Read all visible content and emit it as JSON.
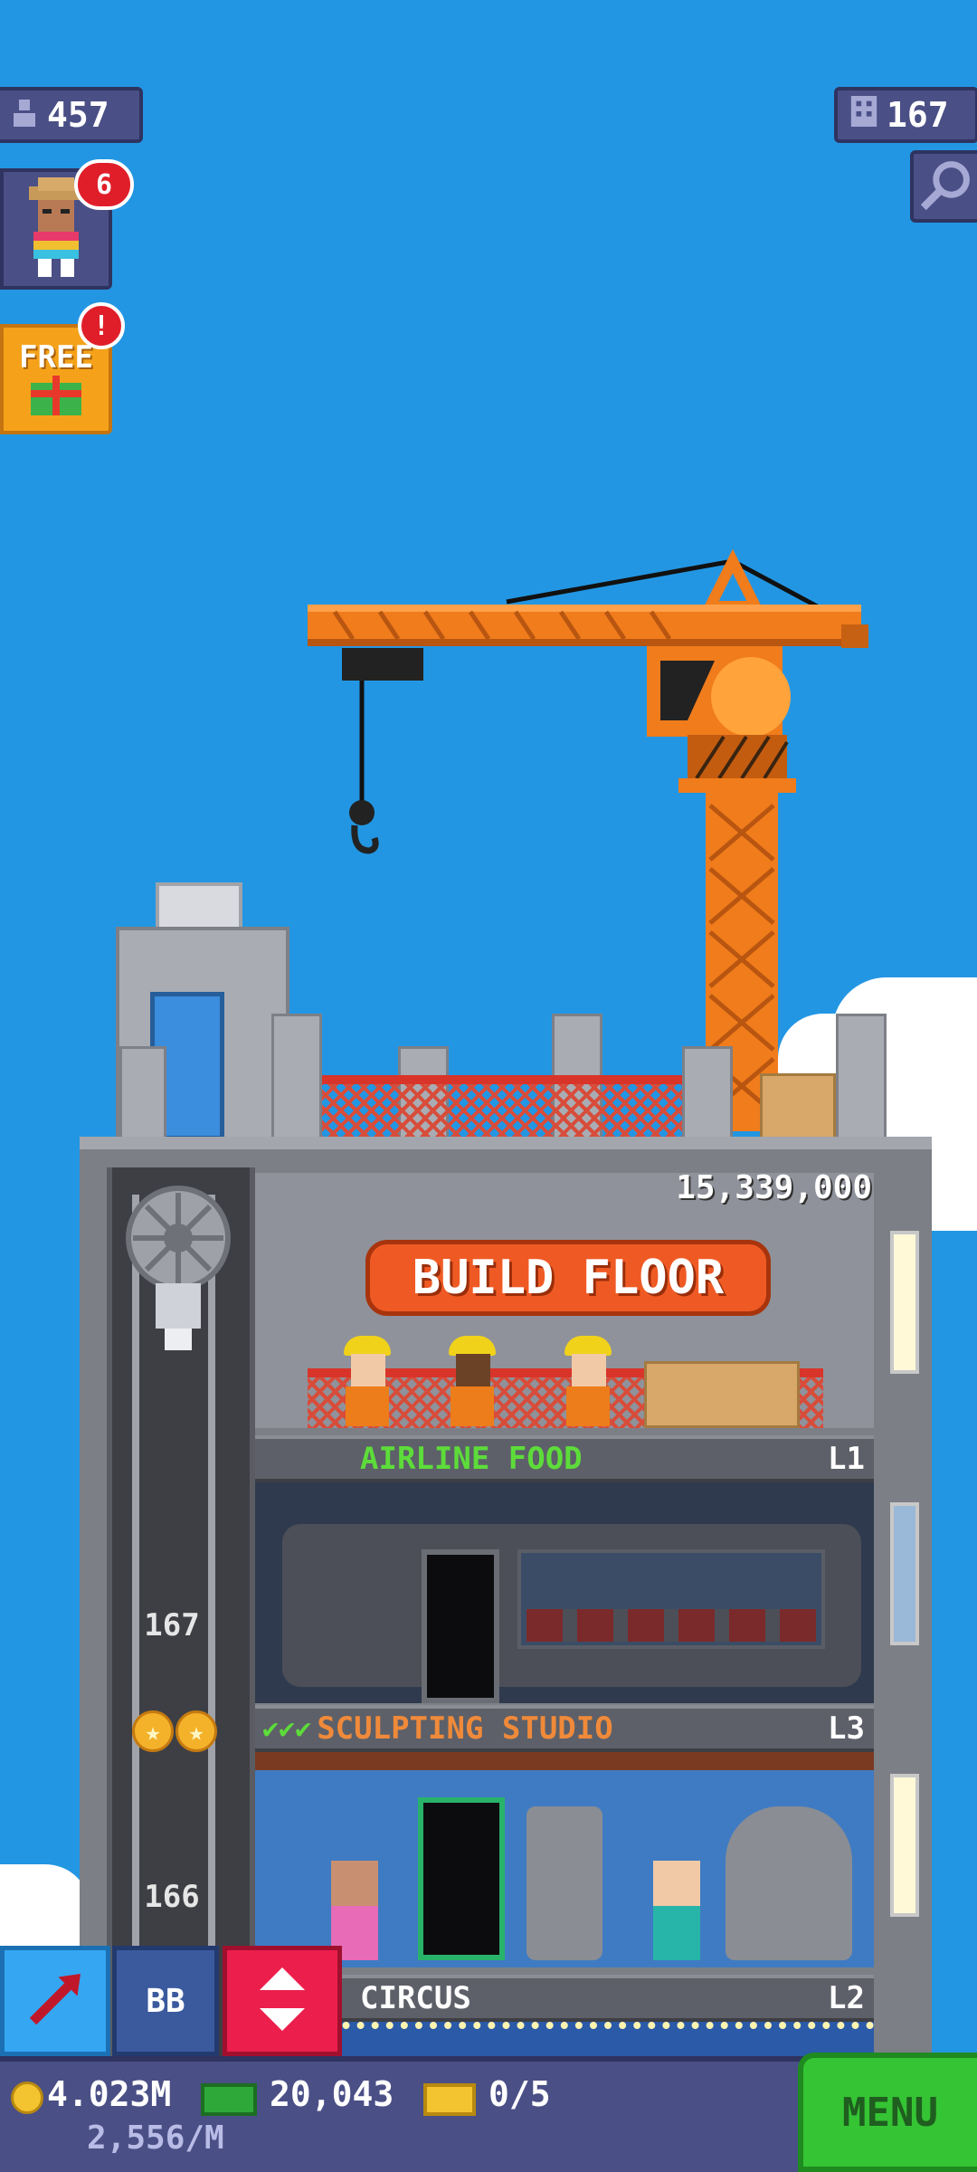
{
  "hud": {
    "population": "457",
    "floors": "167",
    "notification_count": "6",
    "free_label": "FREE",
    "free_badge": "!"
  },
  "tower": {
    "build_cost": "15,339,000",
    "build_label": "BUILD FLOOR",
    "elevator_floors": [
      "167",
      "166"
    ],
    "floors": [
      {
        "name": "AIRLINE FOOD",
        "level": "L1",
        "name_color": "#5ddc3a"
      },
      {
        "name": "SCULPTING STUDIO",
        "level": "L3",
        "name_color": "#f08a3a"
      },
      {
        "name": "CIRCUS",
        "level": "L2",
        "name_color": "#ffffff"
      }
    ]
  },
  "toolbar": {
    "bb_label": "BB",
    "coins": "4.023M",
    "coin_rate": "2,556/M",
    "bux": "20,043",
    "tickets": "0/5",
    "menu_label": "MENU"
  },
  "colors": {
    "sky": "#2396e3",
    "crane": "#f07c1c",
    "build_button": "#ef5a24",
    "menu_button": "#35c434"
  },
  "icons": [
    "person-icon",
    "building-icon",
    "magnifier-icon",
    "gift-icon",
    "arrow-icon",
    "elevator-arrows-icon",
    "coin-icon",
    "bux-icon",
    "ticket-icon"
  ]
}
